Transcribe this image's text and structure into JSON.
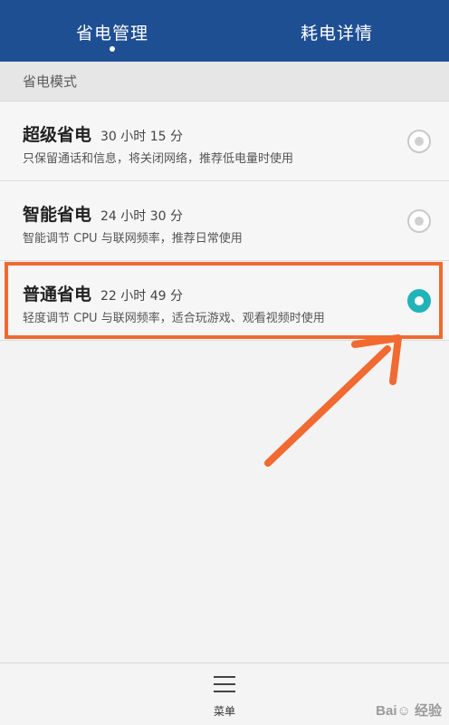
{
  "tabs": [
    {
      "label": "省电管理",
      "active": true
    },
    {
      "label": "耗电详情",
      "active": false
    }
  ],
  "section_title": "省电模式",
  "modes": [
    {
      "name": "超级省电",
      "time": "30 小时 15 分",
      "desc": "只保留通话和信息，将关闭网络，推荐低电量时使用",
      "selected": false
    },
    {
      "name": "智能省电",
      "time": "24 小时 30 分",
      "desc": "智能调节 CPU 与联网频率，推荐日常使用",
      "selected": false
    },
    {
      "name": "普通省电",
      "time": "22 小时 49 分",
      "desc": "轻度调节 CPU 与联网频率，适合玩游戏、观看视频时使用",
      "selected": true
    }
  ],
  "menu_label": "菜单",
  "watermark": "Bai☺ 经验",
  "colors": {
    "header": "#1f4f93",
    "accent": "#22b3b8",
    "highlight": "#f06a31"
  }
}
